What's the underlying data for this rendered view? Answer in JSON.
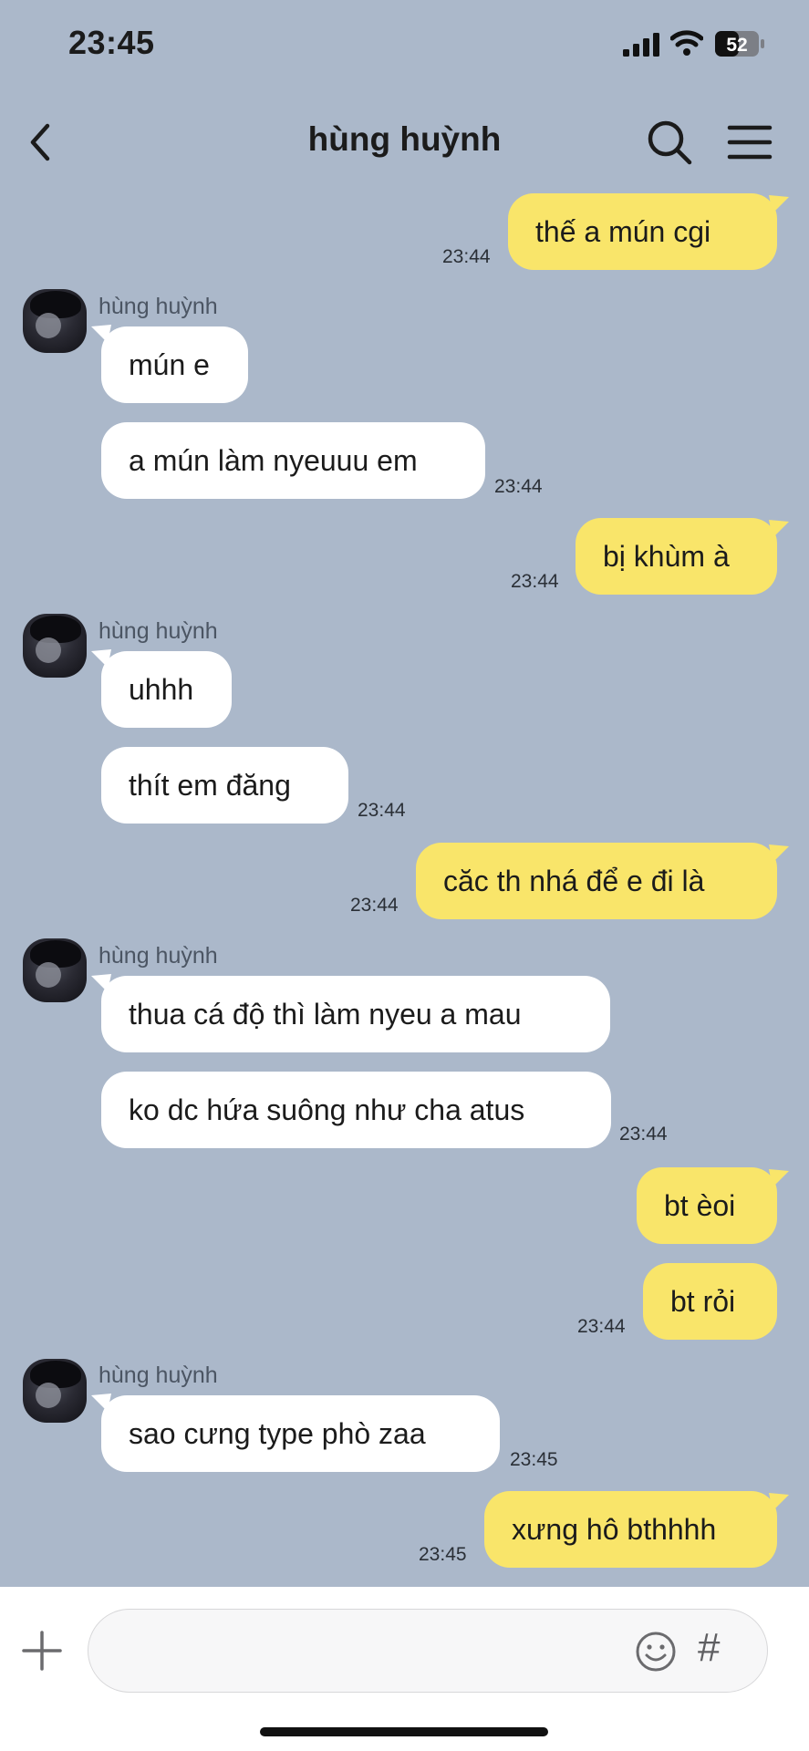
{
  "status": {
    "time": "23:45",
    "battery": "52"
  },
  "header": {
    "title": "hùng huỳnh"
  },
  "contact_name": "hùng huỳnh",
  "messages": [
    {
      "text": "thế a mún cgi",
      "time": "23:44"
    },
    {
      "text": "mún e"
    },
    {
      "text": "a mún làm nyeuuu em",
      "time": "23:44"
    },
    {
      "text": "bị khùm à",
      "time": "23:44"
    },
    {
      "text": "uhhh"
    },
    {
      "text": "thít em đăng",
      "time": "23:44"
    },
    {
      "text": "căc th nhá để e đi là",
      "time": "23:44"
    },
    {
      "text": "thua cá độ thì làm nyeu a mau"
    },
    {
      "text": "ko dc hứa suông như cha atus",
      "time": "23:44"
    },
    {
      "text": "bt èoi"
    },
    {
      "text": "bt rỏi",
      "time": "23:44"
    },
    {
      "text": "sao cưng type phò zaa",
      "time": "23:45"
    },
    {
      "text": "xưng hô bthhhh",
      "time": "23:45"
    }
  ],
  "input": {
    "hash_label": "#"
  },
  "colors": {
    "background": "#abb8ca",
    "outgoing": "#f9e56a",
    "incoming": "#ffffff"
  }
}
